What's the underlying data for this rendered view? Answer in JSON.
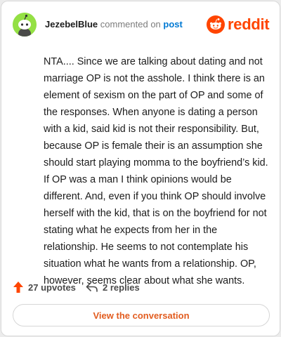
{
  "header": {
    "username": "JezebelBlue",
    "action": "commented on",
    "post_link": "post",
    "brand": "reddit"
  },
  "comment": {
    "text": "NTA.... Since we are talking about dating and not marriage OP is not the asshole. I think there is an element of sexism on the part of OP and some of the responses. When anyone is dating a person with a kid, said kid is not their responsibility. But, because OP is female their is an assumption she should start playing momma to the boyfriend’s kid. If OP was a man I think opinions would be different. And, even if you think OP should involve herself with the kid, that is on the boyfriend for not stating what he expects from her in the relationship. He seems to not contemplate his situation what he wants from a relationship. OP, however, seems clear about what she wants."
  },
  "footer": {
    "upvotes": "27 upvotes",
    "replies": "2 replies",
    "view_button": "View the conversation"
  },
  "colors": {
    "brand": "#ff4500",
    "link": "#0079d3",
    "avatar_bg": "#94e044",
    "cta_text": "#e25c1f"
  },
  "icons": {
    "avatar": "snoo-avatar-icon",
    "brand": "reddit-logo-icon",
    "upvote": "upvote-arrow-icon",
    "reply": "reply-arrow-icon"
  }
}
